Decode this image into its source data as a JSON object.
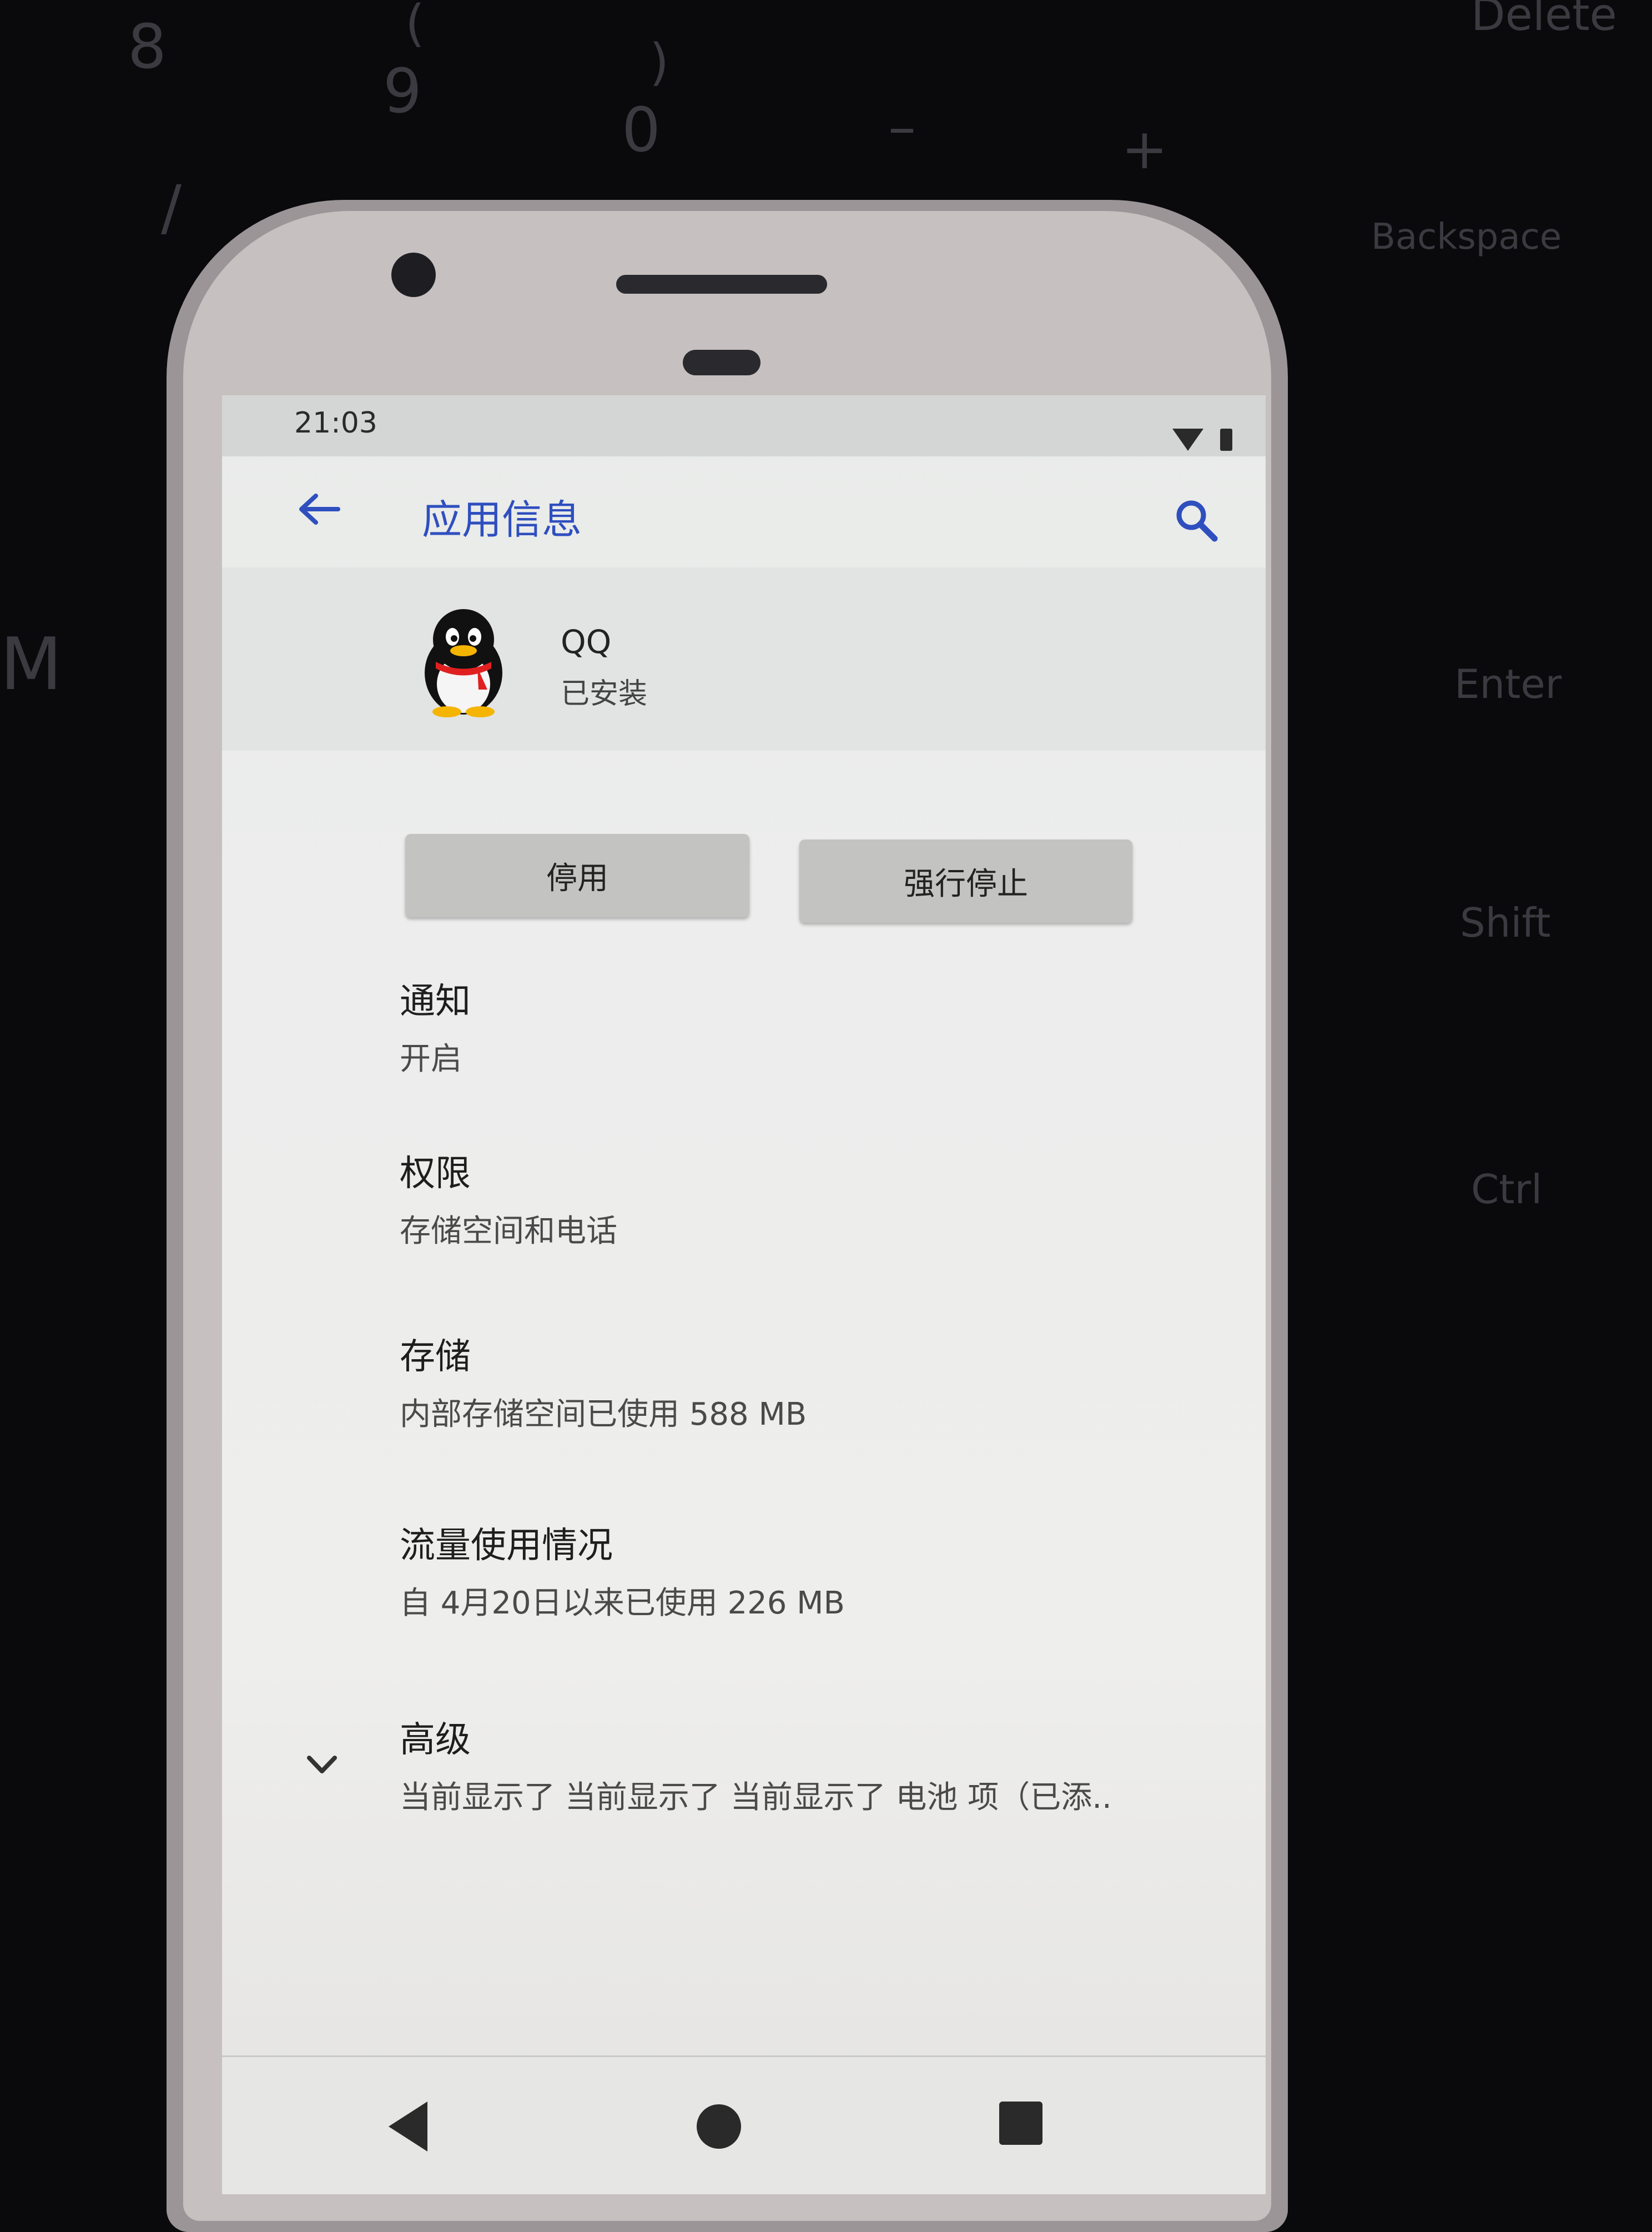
{
  "keyboard": {
    "keys": [
      "8",
      "9",
      "0",
      "(",
      ")",
      "–",
      "+",
      "=",
      "Delete",
      "Backspace",
      "Enter",
      "Shift",
      "Ctrl",
      "M",
      "/"
    ]
  },
  "status_bar": {
    "time": "21:03"
  },
  "app_bar": {
    "title": "应用信息",
    "back_icon": "arrow-left",
    "search_icon": "search"
  },
  "app": {
    "name": "QQ",
    "status": "已安装",
    "icon": "qq-penguin"
  },
  "buttons": {
    "disable": "停用",
    "force_stop": "强行停止"
  },
  "settings": [
    {
      "title": "通知",
      "subtitle": "开启"
    },
    {
      "title": "权限",
      "subtitle": "存储空间和电话"
    },
    {
      "title": "存储",
      "subtitle": "内部存储空间已使用 588 MB"
    },
    {
      "title": "流量使用情况",
      "subtitle": "自 4月20日以来已使用 226 MB"
    },
    {
      "title": "高级",
      "subtitle": "当前显示了 当前显示了 当前显示了 电池 项（已添.."
    }
  ],
  "colors": {
    "accent": "#2f4fbf"
  }
}
